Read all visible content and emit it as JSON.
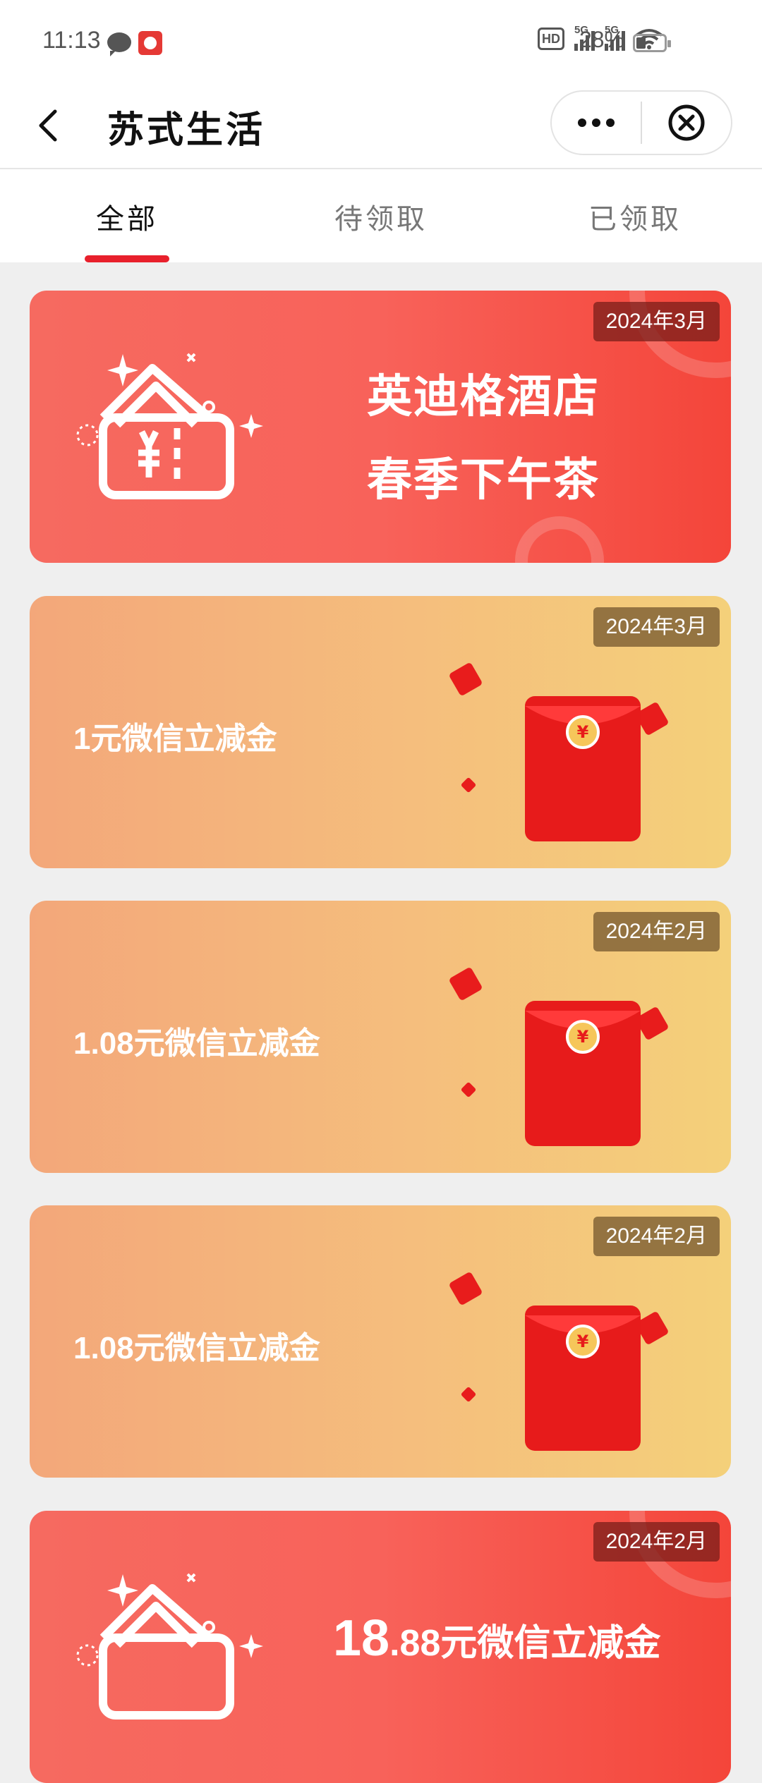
{
  "status_bar": {
    "time": "11:13",
    "network_badge": "HD",
    "signal_1": "5G",
    "signal_2": "5G",
    "battery": "28%"
  },
  "navbar": {
    "title": "苏式生活",
    "back_icon": "chevron-left-icon",
    "more_icon": "more-dots-icon",
    "close_icon": "close-circle-icon"
  },
  "tabs": [
    {
      "label": "全部",
      "active": true
    },
    {
      "label": "待领取",
      "active": false
    },
    {
      "label": "已领取",
      "active": false
    }
  ],
  "colors": {
    "accent": "#e8202c",
    "red_card": "#f8625a",
    "orange_card": "#f5be7d"
  },
  "cards": [
    {
      "type": "ticket",
      "date": "2024年3月",
      "line1": "英迪格酒店",
      "line2": "春季下午茶"
    },
    {
      "type": "red-envelope",
      "date": "2024年3月",
      "title": "1元微信立减金"
    },
    {
      "type": "red-envelope",
      "date": "2024年2月",
      "title": "1.08元微信立减金"
    },
    {
      "type": "red-envelope",
      "date": "2024年2月",
      "title": "1.08元微信立减金"
    },
    {
      "type": "ticket",
      "date": "2024年2月",
      "amount_int": "18",
      "amount_rest": ".88元微信立减金"
    }
  ]
}
